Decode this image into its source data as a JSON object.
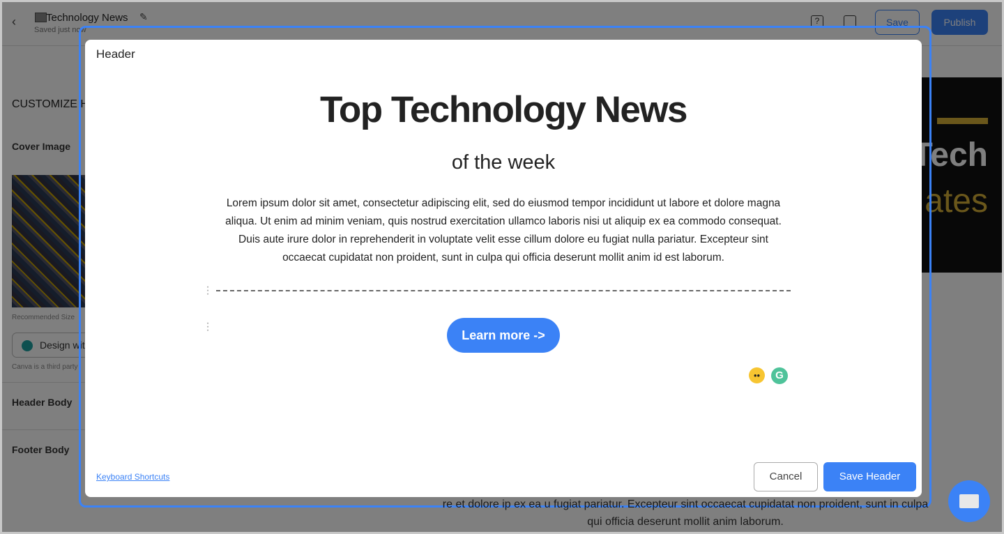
{
  "topbar": {
    "back_icon": "chevron-left-icon",
    "title": "Technology News",
    "status": "Saved just now",
    "help_icon": "?",
    "save_label": "Save",
    "publish_label": "Publish"
  },
  "sidebar": {
    "heading": "CUSTOMIZE HEADER",
    "cover_image_label": "Cover Image",
    "recommended": "Recommended Size",
    "canva_button": "Design with Canva",
    "canva_note": "Canva is a third party",
    "sections": [
      "Header Body",
      "Footer Body"
    ]
  },
  "preview": {
    "hero_word1": "Tech",
    "hero_word2": "ates",
    "body": "re et dolore ip ex ea u fugiat pariatur. Excepteur sint occaecat cupidatat non proident, sunt in culpa qui officia deserunt mollit anim laborum."
  },
  "modal": {
    "title": "Header",
    "heading": "Top Technology News",
    "subheading": "of the week",
    "paragraph": "Lorem ipsum dolor sit amet, consectetur adipiscing elit, sed do eiusmod tempor incididunt ut labore et dolore magna aliqua. Ut enim ad minim veniam, quis nostrud exercitation ullamco laboris nisi ut aliquip ex ea commodo consequat. Duis aute irure dolor in reprehenderit in voluptate velit esse cillum dolore eu fugiat nulla pariatur. Excepteur sint occaecat cupidatat non proident, sunt in culpa qui officia deserunt mollit anim id est laborum.",
    "button_label": "Learn more ->",
    "keyboard_shortcuts": "Keyboard Shortcuts",
    "cancel_label": "Cancel",
    "save_label": "Save Header"
  },
  "colors": {
    "accent": "#3b82f6",
    "hero_gold": "#d4af37"
  }
}
